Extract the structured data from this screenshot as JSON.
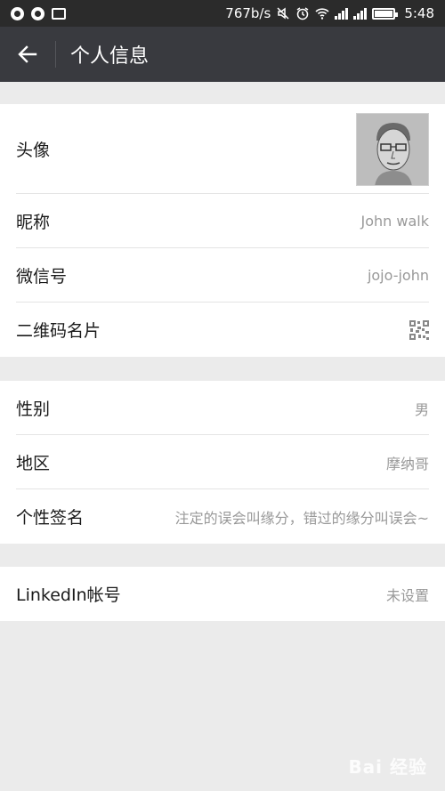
{
  "status_bar": {
    "net_speed": "767b/s",
    "time": "5:48"
  },
  "header": {
    "title": "个人信息",
    "back_icon": "arrow-left-icon"
  },
  "group1": {
    "avatar_label": "头像",
    "nickname_label": "昵称",
    "nickname_value": "John walk",
    "wechat_id_label": "微信号",
    "wechat_id_value": "jojo-john",
    "qrcode_label": "二维码名片",
    "qrcode_icon": "qr-code-icon"
  },
  "group2": {
    "gender_label": "性别",
    "gender_value": "男",
    "region_label": "地区",
    "region_value": "摩纳哥",
    "signature_label": "个性签名",
    "signature_value": "注定的误会叫缘分，错过的缘分叫误会~"
  },
  "group3": {
    "linkedin_label": "LinkedIn帐号",
    "linkedin_value": "未设置"
  },
  "watermark": "Bai 经验"
}
